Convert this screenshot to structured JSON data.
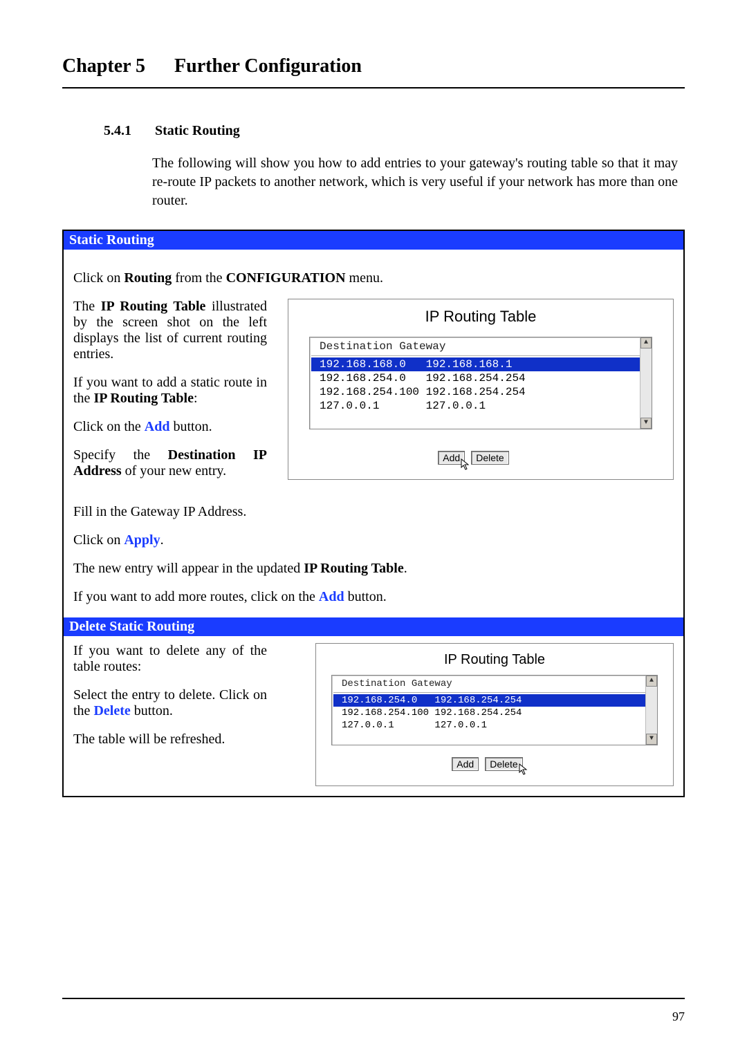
{
  "header": {
    "chapter": "Chapter 5",
    "title": "Further Configuration"
  },
  "subsection": {
    "number": "5.4.1",
    "title": "Static Routing"
  },
  "intro": "The following will show you how to add entries to your gateway's routing table so that it may re-route IP packets to another network, which is very useful if your network has more than one router.",
  "box1": {
    "bar": "Static Routing",
    "line1_a": "Click on ",
    "line1_b": "Routing",
    "line1_c": " from the ",
    "line1_d": "CONFIGURATION",
    "line1_e": " menu.",
    "p2_a": "The ",
    "p2_b": "IP Routing Table",
    "p2_c": " illustrated by the screen shot on the left displays the list of current routing entries.",
    "p3_a": "If you want to add a static route in the ",
    "p3_b": "IP Routing Table",
    "p3_c": ":",
    "p4_a": "Click on the ",
    "p4_b": "Add",
    "p4_c": " button.",
    "p5_a": "Specify the ",
    "p5_b": "Destination IP Address",
    "p5_c": " of your new entry.",
    "p6": "Fill in the Gateway IP Address.",
    "p7_a": "Click on ",
    "p7_b": "Apply",
    "p7_c": ".",
    "p8_a": "The new entry will appear in the updated ",
    "p8_b": "IP Routing Table",
    "p8_c": ".",
    "p9_a": "If you want to add more routes, click on the ",
    "p9_b": "Add",
    "p9_c": " button."
  },
  "shot1": {
    "title": "IP Routing Table",
    "col_dest": "Destination",
    "col_gw": "Gateway",
    "rows": [
      {
        "dest": "192.168.168.0",
        "gw": "192.168.168.1",
        "selected": true
      },
      {
        "dest": "192.168.254.0",
        "gw": "192.168.254.254",
        "selected": false
      },
      {
        "dest": "192.168.254.100",
        "gw": "192.168.254.254",
        "selected": false
      },
      {
        "dest": "127.0.0.1",
        "gw": "127.0.0.1",
        "selected": false
      }
    ],
    "btn_add": "Add",
    "btn_delete": "Delete"
  },
  "box2": {
    "bar": "Delete Static Routing",
    "p1": "If you want to delete any of the table routes:",
    "p2_a": "Select the entry to delete. Click on the ",
    "p2_b": "Delete",
    "p2_c": " button.",
    "p3": "The table will be refreshed."
  },
  "shot2": {
    "title": "IP Routing Table",
    "col_dest": "Destination",
    "col_gw": "Gateway",
    "rows": [
      {
        "dest": "192.168.254.0",
        "gw": "192.168.254.254",
        "selected": true
      },
      {
        "dest": "192.168.254.100",
        "gw": "192.168.254.254",
        "selected": false
      },
      {
        "dest": "127.0.0.1",
        "gw": "127.0.0.1",
        "selected": false
      }
    ],
    "btn_add": "Add",
    "btn_delete": "Delete"
  },
  "page_number": "97"
}
